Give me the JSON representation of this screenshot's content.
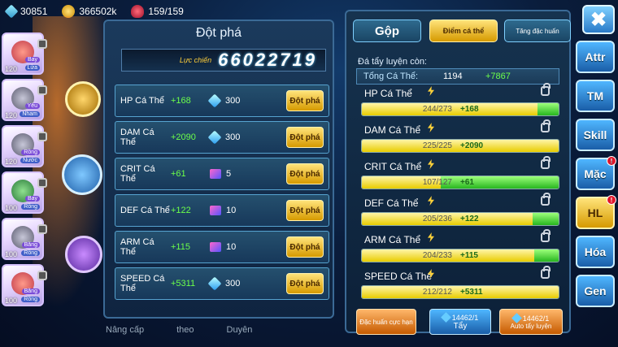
{
  "resources": {
    "gems": "30851",
    "gold": "366502k",
    "stamina": "159/159"
  },
  "pets": [
    {
      "level": "120",
      "element": "Lửa",
      "tag": "Bay",
      "style": "a"
    },
    {
      "level": "120",
      "element": "Nham",
      "tag": "Yêu",
      "style": "b"
    },
    {
      "level": "120",
      "element": "Nước",
      "tag": "Rồng",
      "style": "b"
    },
    {
      "level": "100",
      "element": "Rồng",
      "tag": "Bay",
      "style": "c"
    },
    {
      "level": "100",
      "element": "Rồng",
      "tag": "Băng",
      "style": "b"
    },
    {
      "level": "100",
      "element": "Rồng",
      "tag": "Băng",
      "style": "a"
    }
  ],
  "breakthrough": {
    "title": "Đột phá",
    "power_label": "Lực chiến",
    "power_value": "66022719",
    "button_label": "Đột phá",
    "rows": [
      {
        "name": "HP Cá Thể",
        "plus": "+168",
        "cost": "300",
        "cost_icon": "gem-icon"
      },
      {
        "name": "DAM Cá Thể",
        "plus": "+2090",
        "cost": "300",
        "cost_icon": "gem-icon"
      },
      {
        "name": "CRIT Cá Thể",
        "plus": "+61",
        "cost": "5",
        "cost_icon": "scroll-icon"
      },
      {
        "name": "DEF Cá Thể",
        "plus": "+122",
        "cost": "10",
        "cost_icon": "scroll-icon"
      },
      {
        "name": "ARM Cá Thể",
        "plus": "+115",
        "cost": "10",
        "cost_icon": "scroll-icon"
      },
      {
        "name": "SPEED Cá Thể",
        "plus": "+5311",
        "cost": "300",
        "cost_icon": "gem-icon"
      }
    ]
  },
  "bottom_nav": [
    "Nâng cấp",
    "theo",
    "Duyên"
  ],
  "stats_panel": {
    "tabs": {
      "gop": "Gộp",
      "diem": "Điểm cá thể",
      "dac": "Tăng đặc huấn"
    },
    "remaining_label": "Đá tẩy luyện còn:",
    "total_label": "Tổng Cá Thể:",
    "total_value": "1194",
    "total_plus": "+7867",
    "stats": [
      {
        "name": "HP Cá Thể",
        "current": "244/273",
        "plus": "+168",
        "fill": 0.894,
        "bonus": 0.106
      },
      {
        "name": "DAM Cá Thể",
        "current": "225/225",
        "plus": "+2090",
        "fill": 1.0,
        "bonus": 0
      },
      {
        "name": "CRIT Cá Thể",
        "current": "107/127",
        "plus": "+61",
        "fill": 0.4,
        "bonus": 0.6
      },
      {
        "name": "DEF Cá Thể",
        "current": "205/236",
        "plus": "+122",
        "fill": 0.869,
        "bonus": 0.131
      },
      {
        "name": "ARM Cá Thể",
        "current": "204/233",
        "plus": "+115",
        "fill": 0.876,
        "bonus": 0.124
      },
      {
        "name": "SPEED Cá Thể",
        "current": "212/212",
        "plus": "+5311",
        "fill": 1.0,
        "bonus": 0
      }
    ],
    "buttons": {
      "dac": "Đặc huấn cực hạn",
      "tay_count": "14462/1",
      "tay_label": "Tẩy",
      "auto_count": "14462/1",
      "auto_label": "Auto tẩy luyện"
    }
  },
  "side_nav": [
    {
      "label": "Attr",
      "badge": false,
      "active": false
    },
    {
      "label": "TM",
      "badge": false,
      "active": false
    },
    {
      "label": "Skill",
      "badge": false,
      "active": false
    },
    {
      "label": "Mặc",
      "badge": true,
      "active": false
    },
    {
      "label": "HL",
      "badge": true,
      "active": true
    },
    {
      "label": "Hóa",
      "badge": false,
      "active": false
    },
    {
      "label": "Gen",
      "badge": false,
      "active": false
    }
  ],
  "badge_mark": "!",
  "close_label": "✖"
}
